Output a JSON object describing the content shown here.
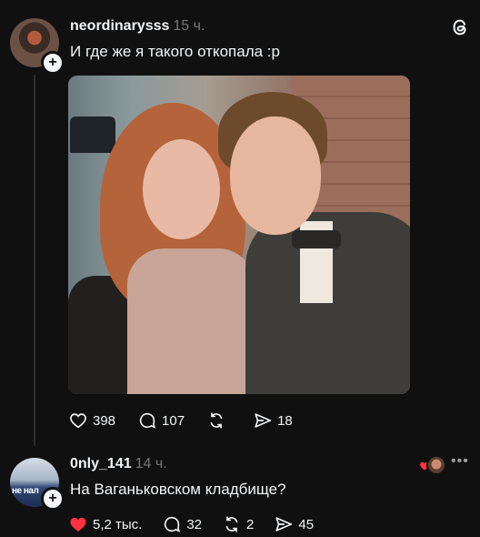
{
  "post": {
    "username": "neordinarysss",
    "time": "15 ч.",
    "text": "И где же я такого откопала :р",
    "stats": {
      "likes": "398",
      "comments": "107",
      "reposts": "",
      "shares": "18"
    }
  },
  "reply": {
    "username": "0nly_141",
    "time": "14 ч.",
    "text": "На Ваганьковском кладбище?",
    "avatar_text": "не нал",
    "stats": {
      "likes": "5,2 тыс.",
      "comments": "32",
      "reposts": "2",
      "shares": "45"
    }
  },
  "icons": {
    "like": "heart-icon",
    "comment": "comment-icon",
    "repost": "repost-icon",
    "share": "share-icon",
    "logo": "threads-logo-icon",
    "follow": "plus-icon",
    "more": "more-icon"
  },
  "colors": {
    "background": "#101010",
    "text": "#f3f5f7",
    "muted": "#777777",
    "liked": "#ff3040"
  }
}
